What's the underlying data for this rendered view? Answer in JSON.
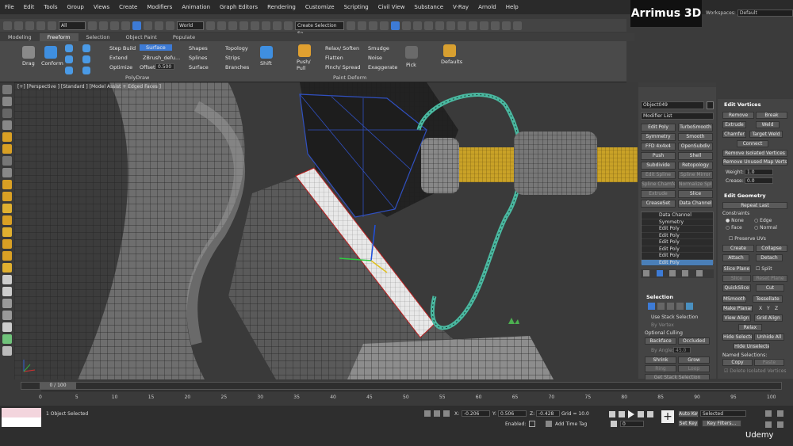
{
  "menu": [
    "File",
    "Edit",
    "Tools",
    "Group",
    "Views",
    "Create",
    "Modifiers",
    "Animation",
    "Graph Editors",
    "Rendering",
    "Customize",
    "Scripting",
    "Civil View",
    "Substance",
    "V-Ray",
    "Arnold",
    "Help"
  ],
  "brand": "Arrimus 3D",
  "workspaces": {
    "label": "Workspaces:",
    "value": "Default"
  },
  "toolbar": {
    "filter": "All",
    "refcoord": "World",
    "selection_set": "Create Selection Se"
  },
  "ribbon_tabs": [
    "Modeling",
    "Freeform",
    "Selection",
    "Object Paint",
    "Populate"
  ],
  "ribbon": {
    "drag": "Drag",
    "conform": "Conform",
    "step_build": "Step Build",
    "extend": "Extend",
    "optimize": "Optimize",
    "surface": "Surface",
    "zbrush": "ZBrush_defu...",
    "offset_label": "Offset:",
    "offset_value": "0.500",
    "shapes": "Shapes",
    "splines": "Splines",
    "surface2": "Surface",
    "topology": "Topology",
    "strips": "Strips",
    "branches": "Branches",
    "shift": "Shift",
    "push_pull": "Push/ Pull",
    "relax_soften": "Relax/ Soften",
    "flatten": "Flatten",
    "pinch_spread": "Pinch/ Spread",
    "smudge": "Smudge",
    "noise": "Noise",
    "exaggerate": "Exaggerate",
    "pick": "Pick",
    "defaults": "Defaults",
    "section_polydraw": "PolyDraw",
    "section_paintdeform": "Paint Deform"
  },
  "viewport_label": "[+] [Perspective ] [Standard ] [Model Assist + Edged Faces ]",
  "command_panel": {
    "object_name": "Object049",
    "modifier_list": "Modifier List",
    "buttons": [
      [
        "Edit Poly",
        "TurboSmooth"
      ],
      [
        "Symmetry",
        "Smooth"
      ],
      [
        "FFD 4x4x4",
        "OpenSubdiv"
      ],
      [
        "Push",
        "Shell"
      ],
      [
        "Subdivide",
        "Retopology"
      ],
      [
        "Edit Spline",
        "Spline Mirror"
      ],
      [
        "Spline Chamfer",
        "Normalize Spline"
      ],
      [
        "Extrude",
        "Slice"
      ],
      [
        "CreaseSet",
        "Data Channel"
      ]
    ],
    "stack": [
      "Data Channel",
      "Symmetry",
      "Edit Poly",
      "Edit Poly",
      "Edit Poly",
      "Edit Poly",
      "Edit Poly",
      "Edit Poly"
    ],
    "selection": {
      "title": "Selection",
      "use_stack": "Use Stack Selection",
      "by_vertex": "By Vertex",
      "optional_culling": "Optional Culling",
      "backface": "Backface",
      "occluded": "Occluded",
      "by_angle": "By Angle:",
      "angle_value": "45.0",
      "shrink": "Shrink",
      "grow": "Grow",
      "ring": "Ring",
      "loop": "Loop",
      "get_stack": "Get Stack Selection"
    }
  },
  "edit_vertices": {
    "title": "Edit Vertices",
    "remove": "Remove",
    "break": "Break",
    "extrude": "Extrude",
    "weld": "Weld",
    "chamfer": "Chamfer",
    "target_weld": "Target Weld",
    "connect": "Connect",
    "remove_isolated": "Remove Isolated Vertices",
    "remove_unused": "Remove Unused Map Verts",
    "weight_label": "Weight:",
    "weight": "1.0",
    "crease_label": "Crease:",
    "crease": "0.0"
  },
  "edit_geometry": {
    "title": "Edit Geometry",
    "repeat_last": "Repeat Last",
    "constraints": "Constraints",
    "none": "None",
    "edge": "Edge",
    "face": "Face",
    "normal": "Normal",
    "preserve_uvs": "Preserve UVs",
    "create": "Create",
    "collapse": "Collapse",
    "attach": "Attach",
    "detach": "Detach",
    "slice_plane": "Slice Plane",
    "split": "Split",
    "slice": "Slice",
    "reset_plane": "Reset Plane",
    "quickslice": "QuickSlice",
    "cut": "Cut",
    "msmooth": "MSmooth",
    "tessellate": "Tessellate",
    "make_planar": "Make Planar",
    "x": "X",
    "y": "Y",
    "z": "Z",
    "view_align": "View Align",
    "grid_align": "Grid Align",
    "relax": "Relax",
    "hide_selected": "Hide Selected",
    "unhide_all": "Unhide All",
    "hide_unselected": "Hide Unselected",
    "named_selections": "Named Selections:",
    "copy": "Copy",
    "paste": "Paste",
    "delete_isolated": "Delete Isolated Vertices"
  },
  "timeline": {
    "frame": "0 / 100",
    "ticks": [
      "0",
      "5",
      "10",
      "15",
      "20",
      "25",
      "30",
      "35",
      "40",
      "45",
      "50",
      "55",
      "60",
      "65",
      "70",
      "75",
      "80",
      "85",
      "90",
      "95",
      "100"
    ]
  },
  "status": {
    "selected": "1 Object Selected",
    "x_label": "X:",
    "x": "-0.206",
    "y_label": "Y:",
    "y": "0.506",
    "z_label": "Z:",
    "z": "-0.428",
    "grid": "Grid = 10.0",
    "enabled": "Enabled:",
    "add_time_tag": "Add Time Tag",
    "auto_key": "Auto Key",
    "selected_dd": "Selected",
    "set_key": "Set Key",
    "key_filters": "Key Filters...",
    "frame_value": "0",
    "watermark": "Udemy"
  }
}
